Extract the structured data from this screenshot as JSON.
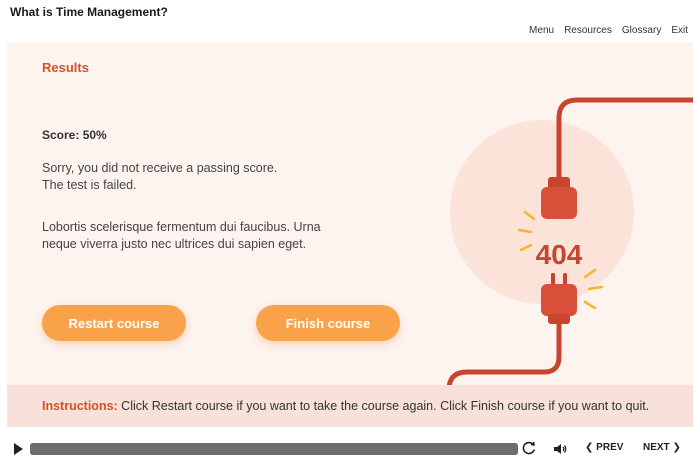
{
  "window": {
    "title": "What is Time Management?"
  },
  "nav": {
    "menu": "Menu",
    "resources": "Resources",
    "glossary": "Glossary",
    "exit": "Exit"
  },
  "content": {
    "heading": "Results",
    "score_label": "Score:",
    "score_value": "50%",
    "message_line1": "Sorry, you did not receive a passing score.",
    "message_line2": "The test is failed.",
    "lorem_line1": "Lobortis scelerisque fermentum dui faucibus. Urna",
    "lorem_line2": "neque viverra justo nec ultrices dui sapien eget.",
    "restart_label": "Restart course",
    "finish_label": "Finish course",
    "illustration_text": "404"
  },
  "instructions": {
    "label": "Instructions:",
    "text": " Click Restart course if you want to take the course again. Click Finish course if you want to quit."
  },
  "player": {
    "progress": 1.0,
    "prev_label": "PREV",
    "next_label": "NEXT"
  },
  "colors": {
    "accent": "#d2532c",
    "button": "#f9a24a",
    "slide_bg": "#fdf3ef",
    "instructions_bg": "#f8e1d8",
    "plug": "#d9503a",
    "circle": "#fbe3d9"
  },
  "icons": {
    "play": "play-icon",
    "replay": "replay-icon",
    "volume": "volume-icon",
    "prev": "chevron-left-icon",
    "next": "chevron-right-icon"
  }
}
